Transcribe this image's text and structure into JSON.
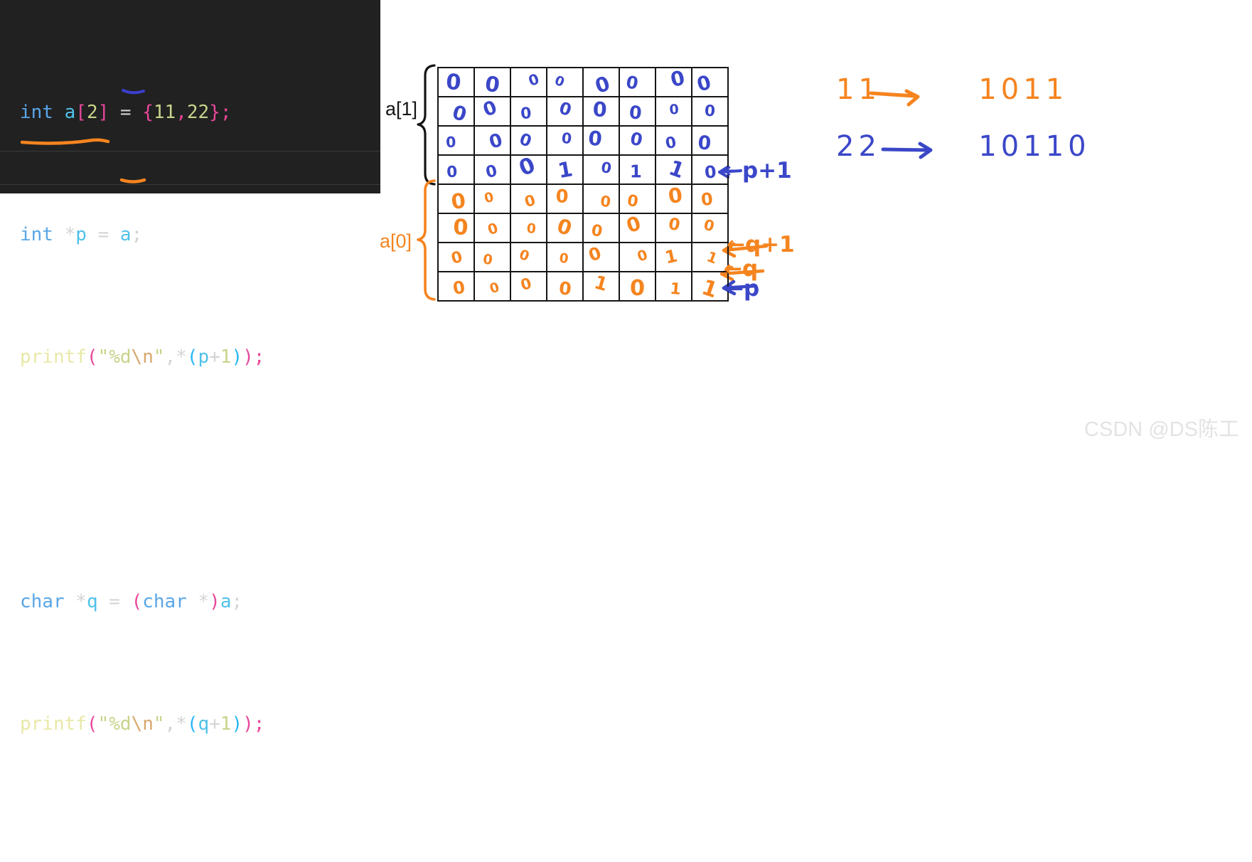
{
  "code": {
    "lines": [
      {
        "id": "line1",
        "text": "int a[2] = {11,22};"
      },
      {
        "id": "line2",
        "text": "int *p = a;"
      },
      {
        "id": "line3",
        "text": "printf(\"%d\\n\",*(p+1));"
      },
      {
        "id": "line4",
        "text": ""
      },
      {
        "id": "line5",
        "text": "char *q = (char *)a;"
      },
      {
        "id": "line6",
        "text": "printf(\"%d\\n\",*(q+1));"
      }
    ],
    "tokens": {
      "kw_int": "int",
      "kw_char": "char",
      "var_a": "a",
      "var_p": "p",
      "var_q": "q",
      "num_2": "2",
      "num_11": "11",
      "num_22": "22",
      "num_1": "1",
      "fn_printf": "printf",
      "str_fmt": "\"%d",
      "esc_n": "\\n",
      "str_close": "\""
    }
  },
  "diagram": {
    "bracket_labels": {
      "a1": "a[1]",
      "a0": "a[0]"
    },
    "pointers": [
      {
        "name": "p-plus-1",
        "label": "←p+1",
        "color": "#3b47c8"
      },
      {
        "name": "q-plus-1",
        "label": "←q+1",
        "color": "#f5841f"
      },
      {
        "name": "q",
        "label": "←q",
        "color": "#f5841f"
      },
      {
        "name": "p",
        "label": "←p",
        "color": "#3b47c8"
      }
    ],
    "grid": {
      "columns": 8,
      "rows": 8,
      "blue_rows": [
        [
          "0",
          "0",
          "0",
          "0",
          "0",
          "0",
          "0",
          "0"
        ],
        [
          "0",
          "0",
          "0",
          "0",
          "0",
          "0",
          "0",
          "0"
        ],
        [
          "0",
          "0",
          "0",
          "0",
          "0",
          "0",
          "0",
          "0"
        ],
        [
          "0",
          "0",
          "0",
          "1",
          "0",
          "1",
          "1",
          "0"
        ]
      ],
      "orange_rows": [
        [
          "0",
          "0",
          "0",
          "0",
          "0",
          "0",
          "0",
          "0"
        ],
        [
          "0",
          "0",
          "0",
          "0",
          "0",
          "0",
          "0",
          "0"
        ],
        [
          "0",
          "0",
          "0",
          "0",
          "0",
          "0",
          "1",
          "1"
        ],
        [
          "0",
          "0",
          "0",
          "0",
          "1",
          "0",
          "1",
          "1"
        ]
      ]
    },
    "notes": [
      {
        "name": "note-11",
        "decimal": "11",
        "arrow": "→",
        "binary": "1011",
        "color": "#f5841f"
      },
      {
        "name": "note-22",
        "decimal": "22",
        "arrow": "→",
        "binary": "10110",
        "color": "#3b47c8"
      }
    ]
  },
  "watermark": {
    "text": "CSDN @DS陈工"
  },
  "colors": {
    "editor_bg": "#212121",
    "page_bg": "#ffffff",
    "blue_ink": "#3b47c8",
    "orange_ink": "#f5841f",
    "grid_line": "#151515"
  }
}
